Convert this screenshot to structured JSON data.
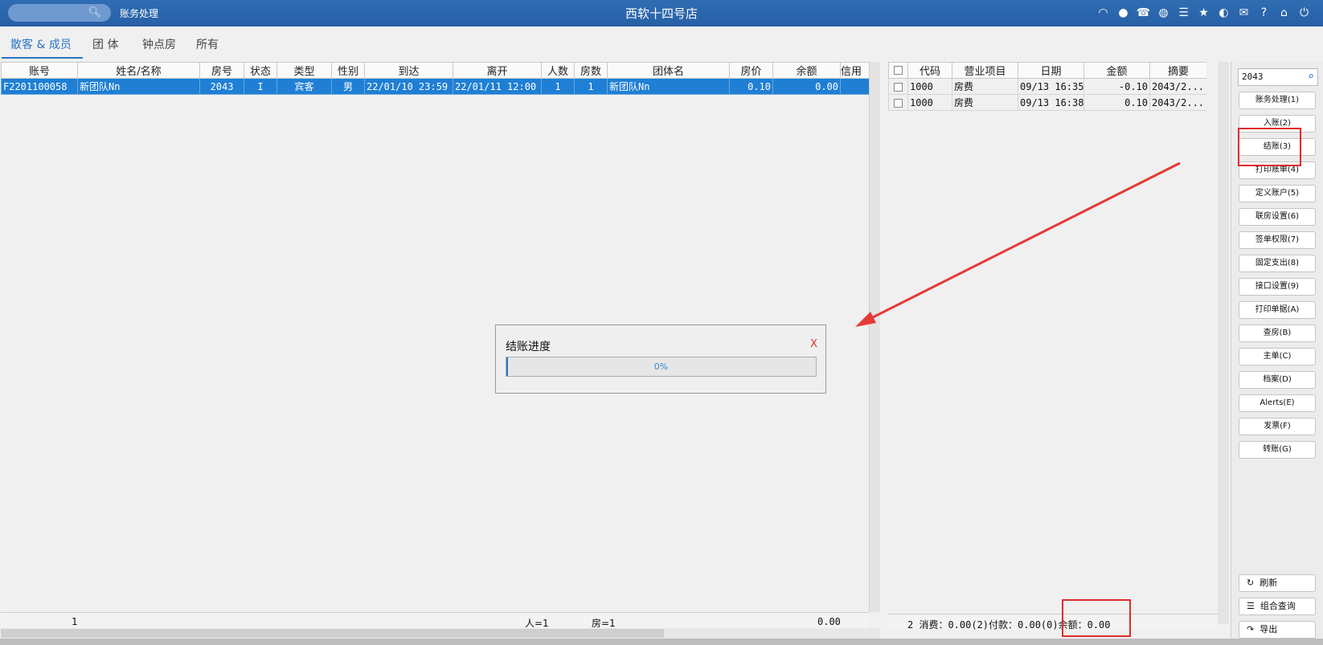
{
  "app": {
    "title": "西软十四号店",
    "module": "账务处理"
  },
  "tabs": [
    "散客 & 成员",
    "团 体",
    "钟点房",
    "所有"
  ],
  "main_table": {
    "columns": [
      "账号",
      "姓名/名称",
      "房号",
      "状态",
      "类型",
      "性别",
      "到达",
      "离开",
      "人数",
      "房数",
      "团体名",
      "房价",
      "余额",
      "信用"
    ],
    "rows": [
      [
        "F2201100058",
        "新团队Nn",
        "2043",
        "I",
        "宾客",
        "男",
        "22/01/10 23:59",
        "22/01/11 12:00",
        "1",
        "1",
        "新团队Nn",
        "0.10",
        "0.00",
        ""
      ]
    ],
    "footer": {
      "count": "1",
      "persons": "人=1",
      "rooms": "房=1",
      "total": "0.00"
    }
  },
  "detail_table": {
    "columns": [
      "代码",
      "营业项目",
      "日期",
      "金额",
      "摘要"
    ],
    "rows": [
      [
        "1000",
        "房费",
        "09/13 16:35",
        "-0.10",
        "2043/2..."
      ],
      [
        "1000",
        "房费",
        "09/13 16:38",
        "0.10",
        "2043/2..."
      ]
    ],
    "footer": "2 消费：0.00(2)付款：0.00(0)余额：0.00"
  },
  "side": {
    "search_value": "2043",
    "buttons": [
      "账务处理(1)",
      "入账(2)",
      "结账(3)",
      "打印账单(4)",
      "定义账户(5)",
      "联房设置(6)",
      "签单权限(7)",
      "固定支出(8)",
      "接口设置(9)",
      "打印单据(A)",
      "查房(B)",
      "主单(C)",
      "档案(D)",
      "Alerts(E)",
      "发票(F)",
      "转账(G)"
    ],
    "bottom_buttons": [
      {
        "icon": "refresh-icon",
        "label": "刷新"
      },
      {
        "icon": "list-icon",
        "label": "组合查询"
      },
      {
        "icon": "export-icon",
        "label": "导出"
      }
    ]
  },
  "dialog": {
    "title": "结账进度",
    "close": "X",
    "progress": 0,
    "progress_text": "0%"
  },
  "colors": {
    "accent": "#2a75c6",
    "selection": "#1f7fd4",
    "annotation": "#e02b2b"
  }
}
